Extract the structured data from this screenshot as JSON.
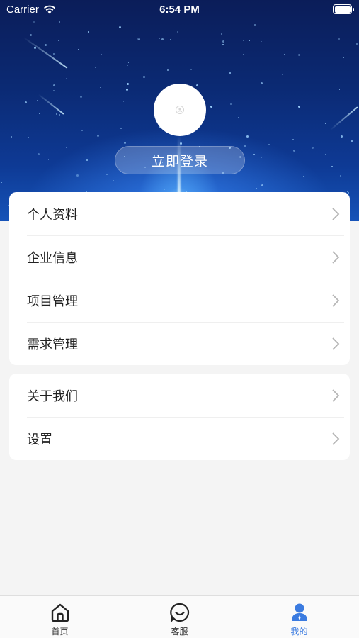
{
  "status_bar": {
    "carrier": "Carrier",
    "time": "6:54 PM"
  },
  "profile": {
    "login_label": "立即登录"
  },
  "menu_primary": [
    {
      "label": "个人资料"
    },
    {
      "label": "企业信息"
    },
    {
      "label": "项目管理"
    },
    {
      "label": "需求管理"
    }
  ],
  "menu_secondary": [
    {
      "label": "关于我们"
    },
    {
      "label": "设置"
    }
  ],
  "tabbar": {
    "items": [
      {
        "label": "首页",
        "icon": "home-icon",
        "active": false
      },
      {
        "label": "客服",
        "icon": "chat-icon",
        "active": false
      },
      {
        "label": "我的",
        "icon": "user-icon",
        "active": true
      }
    ],
    "active_color": "#3b7be0"
  },
  "colors": {
    "hero_dark": "#0b1d59",
    "hero_light": "#1653b8",
    "page_bg": "#f4f4f4"
  }
}
